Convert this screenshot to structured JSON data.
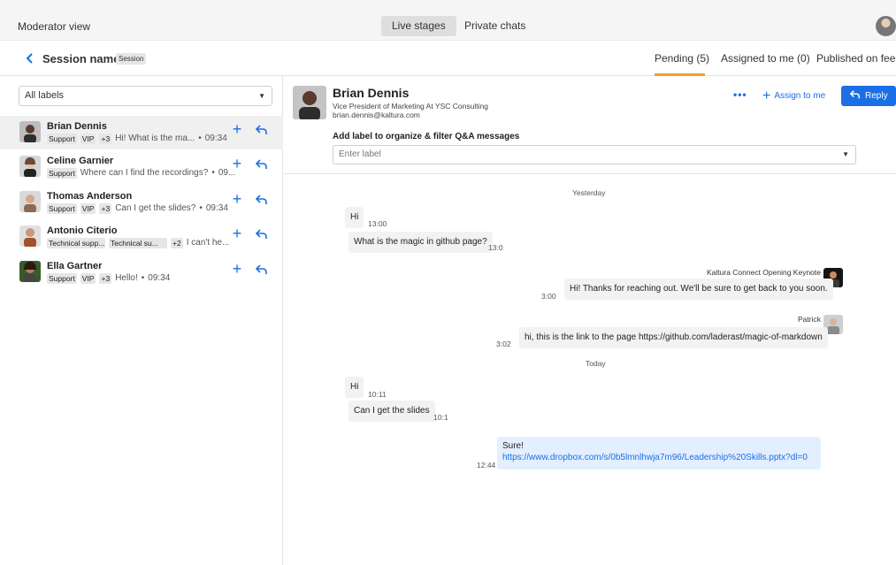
{
  "header": {
    "app_title": "Moderator view",
    "tabs": [
      {
        "label": "Live stages",
        "active": true
      },
      {
        "label": "Private chats",
        "active": false
      }
    ]
  },
  "session": {
    "name": "Session name",
    "tag": "Session",
    "queue_tabs": [
      {
        "label": "Pending (5)",
        "active": true
      },
      {
        "label": "Assigned to me (0)",
        "active": false
      },
      {
        "label": "Published on feed",
        "active": false
      }
    ]
  },
  "sidebar": {
    "filter": "All labels",
    "conversations": [
      {
        "name": "Brian Dennis",
        "tags": [
          "Support",
          "VIP",
          "+3"
        ],
        "preview": "Hi! What is the ma...",
        "time": "09:34",
        "selected": true
      },
      {
        "name": "Celine Garnier",
        "tags": [
          "Support"
        ],
        "preview": "Where can I find the recordings?",
        "time": "09...",
        "selected": false
      },
      {
        "name": "Thomas Anderson",
        "tags": [
          "Support",
          "VIP",
          "+3"
        ],
        "preview": "Can I get the slides?",
        "time": "09:34",
        "selected": false
      },
      {
        "name": "Antonio Citerio",
        "tags": [
          "Technical supp...",
          "Technical su...",
          "+2"
        ],
        "preview": "I can't he...",
        "time": "",
        "selected": false
      },
      {
        "name": "Ella Gartner",
        "tags": [
          "Support",
          "VIP",
          "+3"
        ],
        "preview": "Hello!",
        "time": "09:34",
        "selected": false
      }
    ]
  },
  "detail": {
    "name": "Brian Dennis",
    "title": "Vice President of Marketing At YSC Consulting",
    "email": "brian.dennis@kaltura.com",
    "more_label": "•••",
    "assign_label": "Assign to me",
    "reply_label": "Reply",
    "add_label_heading": "Add label to organize & filter Q&A messages",
    "label_placeholder": "Enter label"
  },
  "chat": {
    "day1": "Yesterday",
    "day2": "Today",
    "messages": [
      {
        "text": "Hi",
        "time": "13:00",
        "from": "user"
      },
      {
        "text": "What is the magic in github page?",
        "time": "13:0",
        "from": "user"
      },
      {
        "sender": "Kaltura Connect Opening Keynote",
        "text": "Hi! Thanks for reaching out. We'll be sure to get back to you soon.",
        "time": "3:00",
        "from": "moderator"
      },
      {
        "sender": "Patrick",
        "text": "hi, this is the link to the page https://github.com/laderast/magic-of-markdown",
        "time": "3:02",
        "from": "moderator"
      },
      {
        "text": "Hi",
        "time": "10:11",
        "from": "user"
      },
      {
        "text": "Can I get the slides",
        "time": "10:1",
        "from": "user"
      },
      {
        "text": "Sure!",
        "link": "https://www.dropbox.com/s/0b5lmnlhwja7m96/Leadership%20Skills.pptx?dl=0",
        "time": "12:44",
        "from": "me"
      }
    ]
  },
  "colors": {
    "accent": "#1b6fe5",
    "tab_underline": "#f0a02a"
  }
}
